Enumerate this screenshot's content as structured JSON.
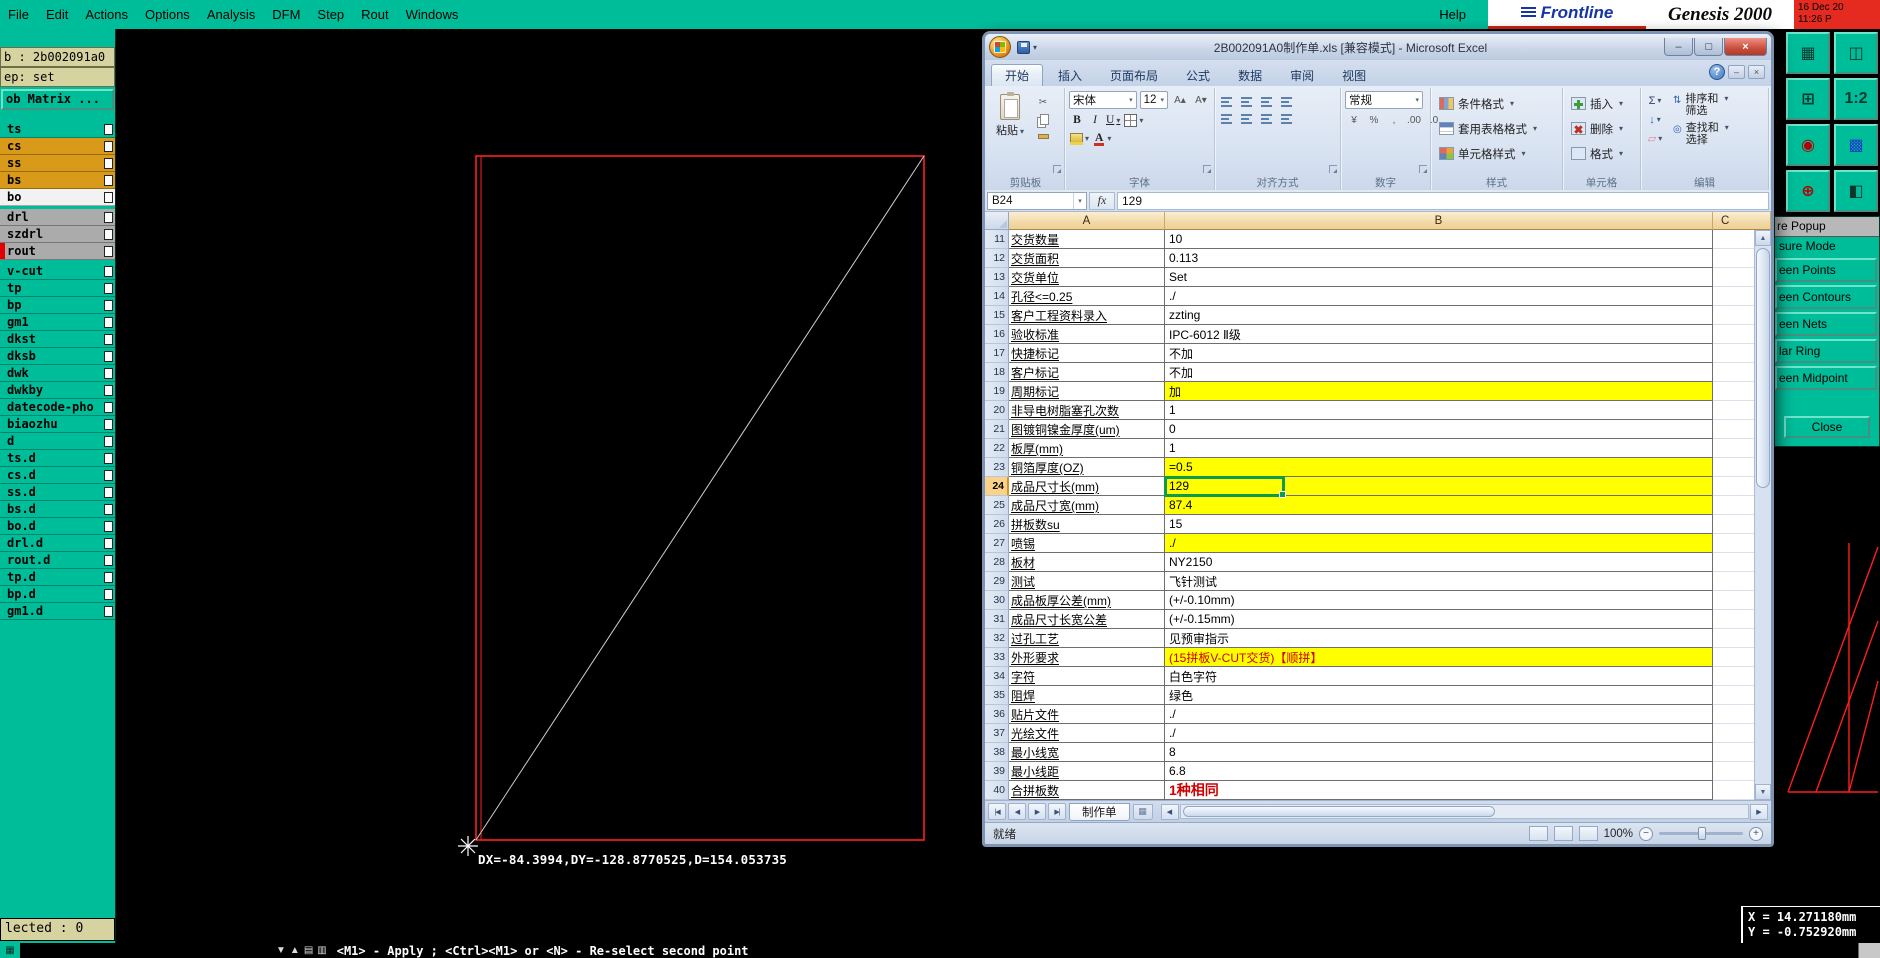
{
  "colors": {
    "teal": "#00BD9A",
    "highlight_yellow": "#FFFF00",
    "selection_green": "#0D9B4D",
    "alert_red": "#D00000",
    "brand_blue": "#1535A8",
    "datetime_red": "#E52A20"
  },
  "genesis": {
    "menu": [
      "File",
      "Edit",
      "Actions",
      "Options",
      "Analysis",
      "DFM",
      "Step",
      "Rout",
      "Windows"
    ],
    "help": "Help",
    "brand": {
      "logo": "Frontline",
      "product": "Genesis 2000",
      "date": "16 Dec 20",
      "time": "11:26 P"
    },
    "sidebar": {
      "job": "b : 2b002091a0",
      "step": "ep: set",
      "matrix_button": "ob Matrix ...",
      "layers": [
        {
          "name": "ts",
          "color": "teal"
        },
        {
          "name": "cs",
          "color": "orange"
        },
        {
          "name": "ss",
          "color": "orange"
        },
        {
          "name": "bs",
          "color": "orange"
        },
        {
          "name": "bo",
          "color": "white"
        },
        {
          "name": "drl",
          "color": "gray",
          "gap": true
        },
        {
          "name": "szdrl",
          "color": "gray"
        },
        {
          "name": "rout",
          "color": "gray",
          "marker": true
        },
        {
          "name": "v-cut",
          "color": "teal",
          "gap": true
        },
        {
          "name": "tp",
          "color": "teal"
        },
        {
          "name": "bp",
          "color": "teal"
        },
        {
          "name": "gm1",
          "color": "teal"
        },
        {
          "name": "dkst",
          "color": "teal"
        },
        {
          "name": "dksb",
          "color": "teal"
        },
        {
          "name": "dwk",
          "color": "teal"
        },
        {
          "name": "dwkby",
          "color": "teal"
        },
        {
          "name": "datecode-pho",
          "color": "teal"
        },
        {
          "name": "biaozhu",
          "color": "teal"
        },
        {
          "name": "d",
          "color": "teal"
        },
        {
          "name": "ts.d",
          "color": "teal"
        },
        {
          "name": "cs.d",
          "color": "teal"
        },
        {
          "name": "ss.d",
          "color": "teal"
        },
        {
          "name": "bs.d",
          "color": "teal"
        },
        {
          "name": "bo.d",
          "color": "teal"
        },
        {
          "name": "drl.d",
          "color": "teal"
        },
        {
          "name": "rout.d",
          "color": "teal"
        },
        {
          "name": "tp.d",
          "color": "teal"
        },
        {
          "name": "bp.d",
          "color": "teal"
        },
        {
          "name": "gm1.d",
          "color": "teal"
        }
      ],
      "selected_label": "lected : 0"
    },
    "canvas": {
      "measure_text": "DX=-84.3994,DY=-128.8770525,D=154.053735"
    },
    "measure_popup": {
      "title": "re Popup",
      "mode_label": "sure Mode",
      "options": [
        "een Points",
        "een Contours",
        "een Nets",
        "lar Ring",
        "een Midpoint"
      ],
      "close_label": "Close"
    },
    "right_toolbar": [
      {
        "name": "screen-grid-icon",
        "glyph": "▦"
      },
      {
        "name": "monitor-icon",
        "glyph": "◫"
      },
      {
        "name": "pan-view-icon",
        "glyph": "⊞"
      },
      {
        "name": "scale-1-2-icon",
        "glyph": "1:2"
      },
      {
        "name": "origin-point-icon",
        "glyph": "◉",
        "color": "#B00000"
      },
      {
        "name": "layer-colors-icon",
        "glyph": "▩",
        "color": "#1A3EC8"
      },
      {
        "name": "zoom-home-icon",
        "glyph": "⊕",
        "color": "#B00000"
      },
      {
        "name": "split-view-icon",
        "glyph": "◧"
      }
    ],
    "bottom_bar": {
      "grid_glyph": "▦",
      "icons": [
        {
          "name": "scroll-down-icon",
          "glyph": "▼"
        },
        {
          "name": "scroll-up-icon",
          "glyph": "▲"
        },
        {
          "name": "doc-icon",
          "glyph": "▤"
        },
        {
          "name": "doc2-icon",
          "glyph": "▥"
        }
      ],
      "hint": "<M1> - Apply ; <Ctrl><M1> or <N> - Re-select second point"
    },
    "coords": {
      "x": "X = 14.271180mm",
      "y": "Y = -0.752920mm"
    }
  },
  "excel": {
    "title": "2B002091A0制作单.xls [兼容模式] - Microsoft Excel",
    "tabs": [
      "开始",
      "插入",
      "页面布局",
      "公式",
      "数据",
      "审阅",
      "视图"
    ],
    "active_tab": "开始",
    "ribbon": {
      "groups": [
        "剪贴板",
        "字体",
        "对齐方式",
        "数字",
        "样式",
        "单元格",
        "编辑"
      ],
      "paste": "粘贴",
      "font_name": "宋体",
      "font_size": "12",
      "bold": "B",
      "italic": "I",
      "underline": "U",
      "number_format": "常规",
      "number_icons": [
        "¥",
        "%",
        ",",
        ".00",
        ".0"
      ],
      "style_buttons": [
        "条件格式",
        "套用表格格式",
        "单元格样式"
      ],
      "cell_buttons": [
        "插入",
        "删除",
        "格式"
      ],
      "sort_lines": [
        "排序和",
        "筛选"
      ],
      "find_lines": [
        "查找和",
        "选择"
      ],
      "icons": {
        "sum": "Σ",
        "fill": "↓",
        "clear": "▱",
        "sort": "⇅",
        "find": "◎",
        "cut": "✂",
        "grow": "A▴",
        "shrink": "A▾"
      }
    },
    "name_box": "B24",
    "fx_label": "fx",
    "formula_value": "129",
    "columns": [
      "A",
      "B",
      "C"
    ],
    "rows": [
      {
        "n": 11,
        "a": "交货数量",
        "b": "10"
      },
      {
        "n": 12,
        "a": "交货面积",
        "b": "0.113"
      },
      {
        "n": 13,
        "a": "交货单位",
        "b": "Set"
      },
      {
        "n": 14,
        "a": "孔径<=0.25",
        "b": "./"
      },
      {
        "n": 15,
        "a": "客户工程资料录入",
        "b": "zzting"
      },
      {
        "n": 16,
        "a": "验收标准",
        "b": "IPC-6012 Ⅱ级"
      },
      {
        "n": 17,
        "a": "快捷标记",
        "b": "不加"
      },
      {
        "n": 18,
        "a": "客户标记",
        "b": "不加"
      },
      {
        "n": 19,
        "a": "周期标记",
        "b": "加",
        "hl": true
      },
      {
        "n": 20,
        "a": "非导电树脂塞孔次数",
        "b": "1"
      },
      {
        "n": 21,
        "a": "图镀铜镍金厚度(um)",
        "b": "0"
      },
      {
        "n": 22,
        "a": "板厚(mm)",
        "b": "1"
      },
      {
        "n": 23,
        "a": "铜箔厚度(OZ)",
        "b": "=0.5",
        "hl": true
      },
      {
        "n": 24,
        "a": "成品尺寸长(mm)",
        "b": "129",
        "hl": true,
        "selected": true
      },
      {
        "n": 25,
        "a": "成品尺寸宽(mm)",
        "b": "87.4",
        "hl": true
      },
      {
        "n": 26,
        "a": "拼板数su",
        "b": "15"
      },
      {
        "n": 27,
        "a": "喷锡",
        "b": "./",
        "hl": true
      },
      {
        "n": 28,
        "a": "板材",
        "b": "NY2150"
      },
      {
        "n": 29,
        "a": "测试",
        "b": "飞针测试"
      },
      {
        "n": 30,
        "a": "成品板厚公差(mm)",
        "b": "(+/-0.10mm)"
      },
      {
        "n": 31,
        "a": "成品尺寸长宽公差",
        "b": "(+/-0.15mm)"
      },
      {
        "n": 32,
        "a": "过孔工艺",
        "b": "见预审指示"
      },
      {
        "n": 33,
        "a": "外形要求",
        "b": "(15拼板V-CUT交货)【顺拼】",
        "hl": true,
        "red": true
      },
      {
        "n": 34,
        "a": "字符",
        "b": "白色字符"
      },
      {
        "n": 35,
        "a": "阻焊",
        "b": "绿色"
      },
      {
        "n": 36,
        "a": "贴片文件",
        "b": "./"
      },
      {
        "n": 37,
        "a": "光绘文件",
        "b": "./"
      },
      {
        "n": 38,
        "a": "最小线宽",
        "b": "8"
      },
      {
        "n": 39,
        "a": "最小线距",
        "b": "6.8"
      },
      {
        "n": 40,
        "a": "合拼板数",
        "b": "1种相同",
        "red": true,
        "big": true
      }
    ],
    "sheet_tab": "制作单",
    "status_ready": "就绪",
    "zoom": "100%"
  }
}
